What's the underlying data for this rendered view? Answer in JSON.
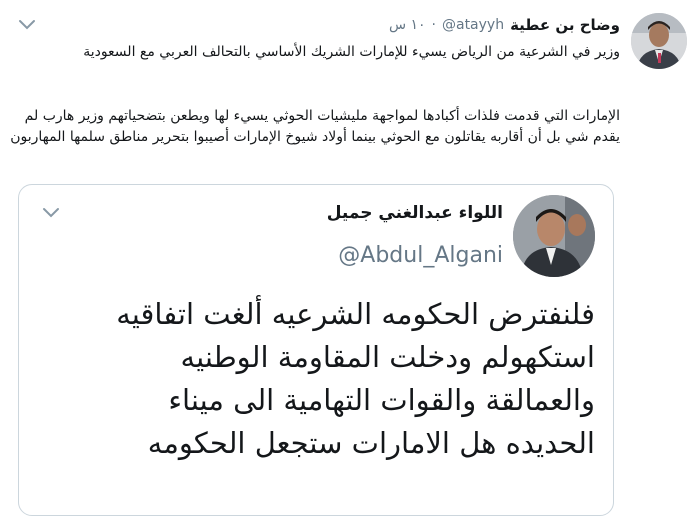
{
  "tweet": {
    "author_name": "وضاح بن عطية",
    "author_handle": "@atayyh",
    "separator": "·",
    "time": "١٠ س",
    "text_1": "وزير في الشرعية من الرياض يسيء للإمارات الشريك الأساسي بالتحالف العربي مع السعودية",
    "text_2": "الإمارات التي قدمت فلذات أكبادها لمواجهة مليشيات الحوثي يسيء لها ويطعن بتضحياتهم وزير هارب لم يقدم شي بل أن أقاربه يقاتلون مع الحوثي بينما أولاد شيوخ الإمارات أصيبوا بتحرير مناطق سلمها المهاربون",
    "menu_icon": "chevron-down-icon"
  },
  "quoted": {
    "name": "اللواء عبدالغني جميل",
    "handle": "@Abdul_Algani",
    "lines": [
      "فلنفترض الحكومه الشرعيه ألغت اتفاقيه",
      "استكهولم ودخلت المقاومة الوطنيه",
      "والعمالقة والقوات التهامية الى ميناء",
      "الحديده هل الامارات ستجعل الحكومه"
    ],
    "menu_icon": "chevron-down-icon"
  },
  "colors": {
    "text": "#14171a",
    "secondary": "#657786",
    "border": "#ccd6dd"
  }
}
